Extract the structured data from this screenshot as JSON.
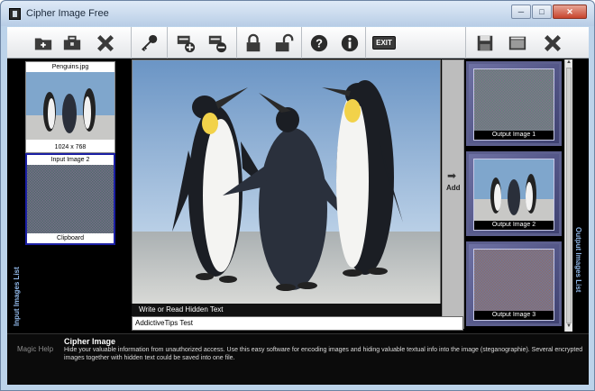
{
  "window": {
    "title": "Cipher Image Free",
    "min": "─",
    "max": "□",
    "close": "✕"
  },
  "toolbar": {
    "buttons": [
      {
        "name": "open-folder",
        "icon": "folder-icon"
      },
      {
        "name": "toolbox",
        "icon": "briefcase-icon"
      },
      {
        "name": "remove-input",
        "icon": "red-x-icon"
      },
      {
        "name": "key",
        "icon": "key-icon"
      },
      {
        "name": "add-text",
        "icon": "note-add-icon"
      },
      {
        "name": "remove-text",
        "icon": "note-remove-icon"
      },
      {
        "name": "lock",
        "icon": "lock-icon"
      },
      {
        "name": "unlock",
        "icon": "unlock-icon"
      },
      {
        "name": "help",
        "icon": "help-icon"
      },
      {
        "name": "info",
        "icon": "info-icon"
      },
      {
        "name": "exit",
        "icon": "exit-icon"
      },
      {
        "name": "save",
        "icon": "floppy-icon"
      },
      {
        "name": "save-as",
        "icon": "window-save-icon"
      },
      {
        "name": "remove-output",
        "icon": "red-x-icon"
      }
    ],
    "exit_label": "EXIT"
  },
  "input_list": {
    "label": "Input Images List",
    "items": [
      {
        "name": "Penguins.jpg",
        "size": "1024 x 768"
      },
      {
        "name": "Input Image 2",
        "footer": "Clipboard"
      }
    ]
  },
  "add_button": {
    "label": "Add"
  },
  "hidden_text": {
    "label": "Write or Read Hidden Text",
    "value": "AddictiveTips Test"
  },
  "output_list": {
    "label": "Output Images List",
    "items": [
      "Output Image 1",
      "Output Image 2",
      "Output Image 3"
    ]
  },
  "bottom": {
    "magic_help": "Magic Help",
    "title": "Cipher Image",
    "description": "Hide your valuable information from unauthorized access. Use this easy software for encoding images and hiding valuable textual info into the image (steganographie). Several encrypted images together with hidden text could be saved into one file."
  }
}
